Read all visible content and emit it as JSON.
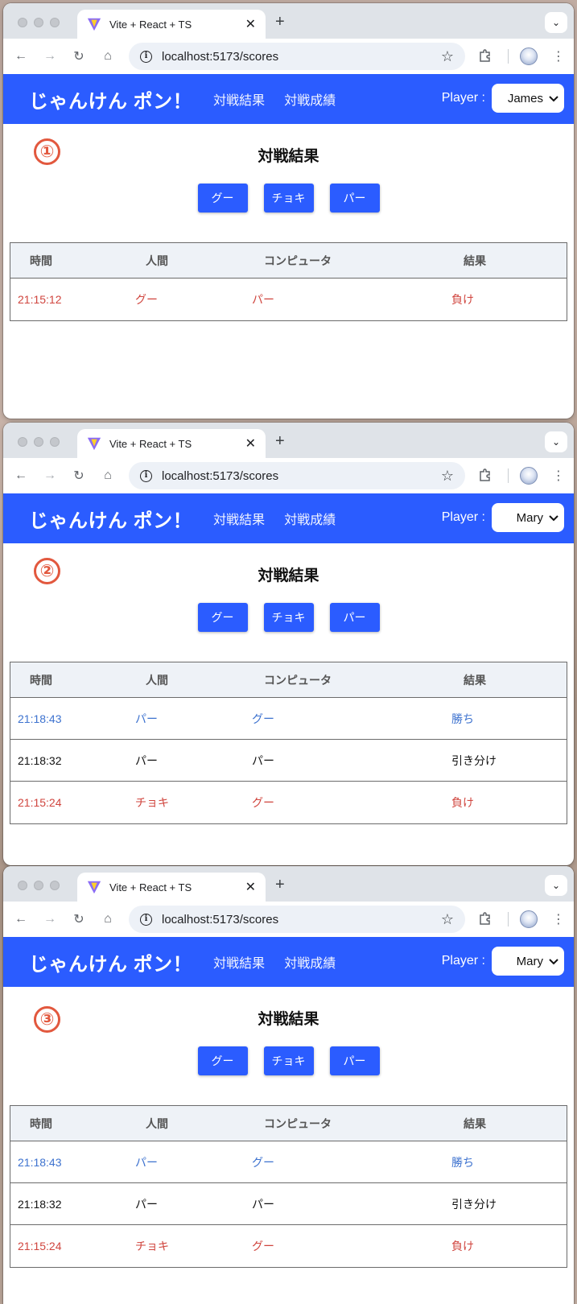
{
  "windows": [
    {
      "tab_title": "Vite + React + TS",
      "url": "localhost:5173/scores",
      "brand": "じゃんけん ポン！",
      "nav": [
        "対戦結果",
        "対戦成績"
      ],
      "player_label": "Player :",
      "player_value": "James",
      "annotation": "①",
      "heading": "対戦結果",
      "hands": [
        "グー",
        "チョキ",
        "パー"
      ],
      "columns": [
        "時間",
        "人間",
        "コンピュータ",
        "結果"
      ],
      "rows": [
        {
          "time": "21:15:12",
          "human": "グー",
          "computer": "パー",
          "result": "負け",
          "status": "lose"
        }
      ]
    },
    {
      "tab_title": "Vite + React + TS",
      "url": "localhost:5173/scores",
      "brand": "じゃんけん ポン！",
      "nav": [
        "対戦結果",
        "対戦成績"
      ],
      "player_label": "Player :",
      "player_value": "Mary",
      "annotation": "②",
      "heading": "対戦結果",
      "hands": [
        "グー",
        "チョキ",
        "パー"
      ],
      "columns": [
        "時間",
        "人間",
        "コンピュータ",
        "結果"
      ],
      "rows": [
        {
          "time": "21:18:43",
          "human": "パー",
          "computer": "グー",
          "result": "勝ち",
          "status": "win"
        },
        {
          "time": "21:18:32",
          "human": "パー",
          "computer": "パー",
          "result": "引き分け",
          "status": "draw"
        },
        {
          "time": "21:15:24",
          "human": "チョキ",
          "computer": "グー",
          "result": "負け",
          "status": "lose"
        }
      ]
    },
    {
      "tab_title": "Vite + React + TS",
      "url": "localhost:5173/scores",
      "brand": "じゃんけん ポン！",
      "nav": [
        "対戦結果",
        "対戦成績"
      ],
      "player_label": "Player :",
      "player_value": "Mary",
      "annotation": "③",
      "heading": "対戦結果",
      "hands": [
        "グー",
        "チョキ",
        "パー"
      ],
      "columns": [
        "時間",
        "人間",
        "コンピュータ",
        "結果"
      ],
      "rows": [
        {
          "time": "21:18:43",
          "human": "パー",
          "computer": "グー",
          "result": "勝ち",
          "status": "win"
        },
        {
          "time": "21:18:32",
          "human": "パー",
          "computer": "パー",
          "result": "引き分け",
          "status": "draw"
        },
        {
          "time": "21:15:24",
          "human": "チョキ",
          "computer": "グー",
          "result": "負け",
          "status": "lose"
        }
      ]
    }
  ],
  "colors": {
    "header_bg": "#2b5cff",
    "button_bg": "#2b5cff",
    "win_text": "#3d72cf",
    "lose_text": "#d0453e",
    "annotation": "#e2583e"
  },
  "icons": [
    "vite-logo-icon",
    "close-icon",
    "plus-icon",
    "chevron-down-icon",
    "back-arrow-icon",
    "forward-arrow-icon",
    "reload-icon",
    "home-icon",
    "info-icon",
    "star-icon",
    "puzzle-extension-icon",
    "profile-avatar-icon",
    "kebab-menu-icon"
  ]
}
